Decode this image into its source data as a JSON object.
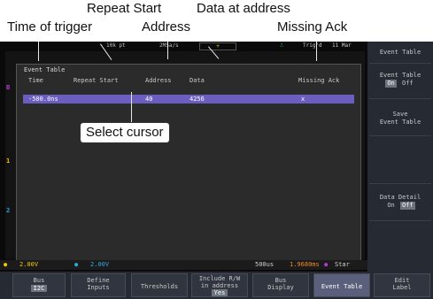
{
  "annotations": {
    "time_of_trigger": "Time of trigger",
    "repeat_start": "Repeat Start",
    "address": "Address",
    "data_at_address": "Data at address",
    "missing_ack": "Missing Ack",
    "select_cursor": "Select cursor"
  },
  "top_bar": {
    "record_length": "10k pt",
    "sample_rate": "2MSa/s",
    "trigger_status": "Trig'd",
    "date": "11 Mar"
  },
  "event_table": {
    "title": "Event Table",
    "columns": [
      "Time",
      "Repeat Start",
      "Address",
      "Data",
      "Missing Ack"
    ],
    "rows": [
      {
        "time": "-500.0ns",
        "repeat_start": "",
        "address": "40",
        "data": "4256",
        "missing_ack": "x"
      }
    ]
  },
  "channel_markers": {
    "ch1": "1",
    "ch2": "2",
    "bus": "B"
  },
  "status_bar": {
    "ch1_scale": "2.00V",
    "ch2_scale": "2.00V",
    "timebase": "500us",
    "trigger_level": "1.9680ms",
    "state": "Star"
  },
  "side_menu": [
    {
      "label": "Event Table",
      "options": []
    },
    {
      "label": "Event Table",
      "options": [
        "On",
        "Off"
      ],
      "selected": "On"
    },
    {
      "label": "Save\nEvent Table",
      "options": []
    },
    {
      "label": "",
      "options": []
    },
    {
      "label": "Data Detail",
      "options": [
        "On",
        "Off"
      ],
      "selected": "Off"
    }
  ],
  "bottom_menu": [
    {
      "label": "Bus",
      "value": "I2C",
      "active": false
    },
    {
      "label": "Define\nInputs",
      "value": "",
      "active": false
    },
    {
      "label": "Thresholds",
      "value": "",
      "active": false
    },
    {
      "label": "Include R/W\nin address",
      "value": "Yes",
      "active": false
    },
    {
      "label": "Bus\nDisplay",
      "value": "",
      "active": false
    },
    {
      "label": "Event Table",
      "value": "",
      "active": true
    },
    {
      "label": "Edit\nLabel",
      "value": "",
      "active": false
    }
  ],
  "colors": {
    "ch1": "#f2c500",
    "ch2": "#2fa7e0",
    "bus": "#b43ad6",
    "selected_row": "#6a5fc0",
    "trigger_level_text": "#f08a24"
  }
}
